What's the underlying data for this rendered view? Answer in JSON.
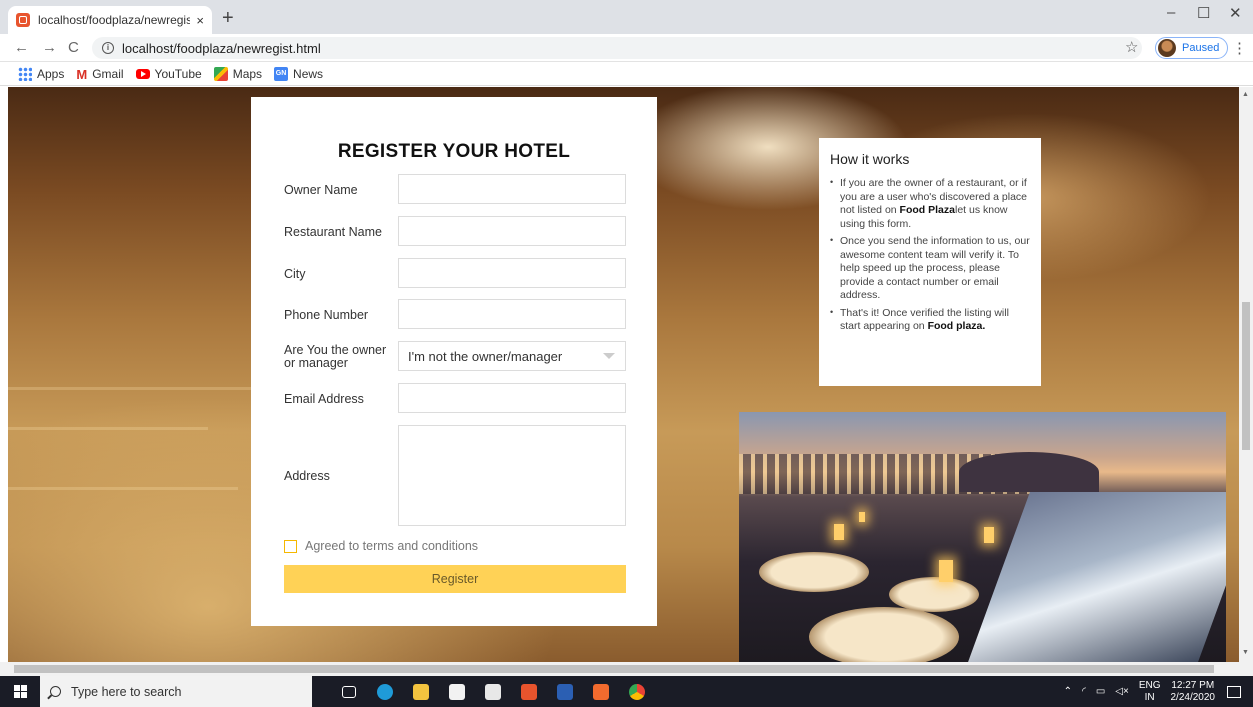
{
  "browser": {
    "tab_title": "localhost/foodplaza/newregist.ht",
    "tab_close": "×",
    "new_tab": "+",
    "url": "localhost/foodplaza/newregist.html",
    "profile_status": "Paused",
    "window_controls": {
      "minimize": "–",
      "maximize": "☐",
      "close": "✕"
    },
    "nav": {
      "back": "←",
      "forward": "→",
      "reload": "C"
    },
    "bookmarks": [
      {
        "label": "Apps",
        "icon": "apps-grid-icon"
      },
      {
        "label": "Gmail",
        "icon": "gmail-icon"
      },
      {
        "label": "YouTube",
        "icon": "youtube-icon"
      },
      {
        "label": "Maps",
        "icon": "maps-icon"
      },
      {
        "label": "News",
        "icon": "news-icon"
      }
    ]
  },
  "form": {
    "title": "REGISTER YOUR HOTEL",
    "fields": {
      "owner_name": "Owner Name",
      "restaurant_name": "Restaurant Name",
      "city": "City",
      "phone": "Phone Number",
      "owner_question_line1": "Are You the owner",
      "owner_question_line2": "or manager",
      "owner_select_value": "I'm not the owner/manager",
      "email": "Email Address",
      "address": "Address"
    },
    "agree_label": "Agreed to terms and conditions",
    "register_label": "Register"
  },
  "how_it_works": {
    "title": "How it works",
    "item1_pre": "If you are the owner of a restaurant, or if you are a user who's discovered a place not listed on ",
    "item1_brand": "Food Plaza",
    "item1_post": "let us know using this form.",
    "item2": "Once you send the information to us, our awesome content team will verify it. To help speed up the process, please provide a contact number or email address.",
    "item3_pre": "That's it! Once verified the listing will start appearing on ",
    "item3_brand": "Food plaza."
  },
  "taskbar": {
    "search_placeholder": "Type here to search",
    "lang_line1": "ENG",
    "lang_line2": "IN",
    "time": "12:27 PM",
    "date": "2/24/2020"
  },
  "colors": {
    "accent_yellow": "#ffd256",
    "checkbox_border": "#f5b800"
  }
}
